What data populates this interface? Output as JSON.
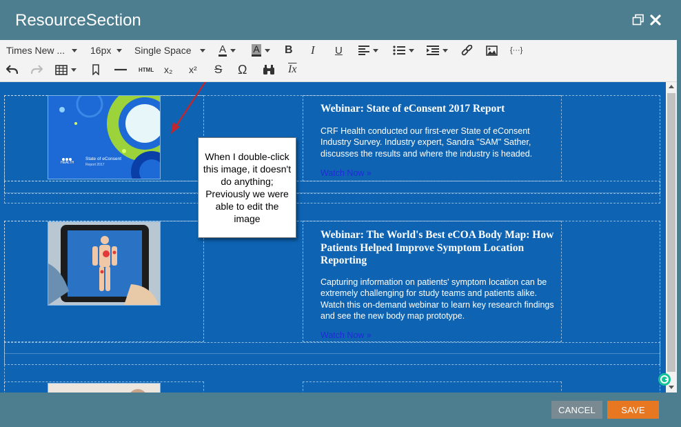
{
  "window": {
    "title": "ResourceSection",
    "restore_icon": "restore-window-icon",
    "close_icon": "close-icon"
  },
  "toolbar": {
    "font_family": "Times New ...",
    "font_size": "16px",
    "line_spacing": "Single Space",
    "row1_icons": [
      "text-color-icon",
      "background-color-icon",
      "bold-icon",
      "italic-icon",
      "underline-icon",
      "align-icon",
      "list-icon",
      "indent-icon",
      "link-icon",
      "image-icon",
      "code-icon"
    ],
    "row2_icons": [
      "undo-icon",
      "redo-icon",
      "table-icon",
      "bookmark-icon",
      "horizontal-rule-icon",
      "html-icon",
      "subscript-icon",
      "superscript-icon",
      "strikethrough-icon",
      "omega-icon",
      "find-icon",
      "clear-format-icon"
    ],
    "html_label": "HTML",
    "omega": "Ω",
    "bold_letter": "B",
    "italic_letter": "I",
    "underline_letter": "U",
    "text_color_letter": "A",
    "bg_color_letter": "A",
    "subscript": "x₂",
    "superscript": "x²",
    "strike_letter": "S",
    "clear_letter": "Ix",
    "code_label": "{···}"
  },
  "content": {
    "items": [
      {
        "title": "Webinar:  State of eConsent 2017 Report",
        "description": "CRF Health conducted our first-ever State of eConsent Industry Survey. Industry expert, Sandra \"SAM\" Sather, discusses the results and where the industry is headed.",
        "link": "Watch Now »",
        "thumbnail_text": "State of eConsent",
        "thumbnail_sub": "Report 2017",
        "thumbnail_brand": "HEALTH"
      },
      {
        "title": "Webinar: The World's Best eCOA Body Map: How Patients Helped Improve Symptom Location Reporting",
        "description": "Capturing information on patients' symptom location can be extremely challenging for study teams and patients alike. Watch this on-demand webinar to learn key research findings and see the new body map prototype.",
        "link": "Watch Now »"
      }
    ]
  },
  "annotation": {
    "text": "When I double-click this image, it doesn't do anything; Previously we were able to edit the image"
  },
  "footer": {
    "cancel_label": "CANCEL",
    "save_label": "SAVE"
  },
  "colors": {
    "editor_bg": "#0e64b3",
    "frame": "#4d7e8f",
    "save": "#e87722",
    "cancel": "#7a8a92",
    "arrow": "#c0272d"
  }
}
